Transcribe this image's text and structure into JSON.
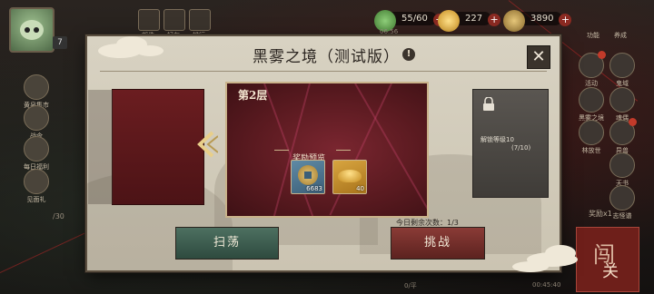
{
  "hud": {
    "level": "7",
    "stamina": "55/60",
    "stamina_timer": "06:56",
    "gold_ingot": "227",
    "coins": "3890",
    "top_icons": [
      {
        "icon": "mail-icon",
        "label": "邮件"
      },
      {
        "icon": "friends-icon",
        "label": "好友"
      },
      {
        "icon": "rank-icon",
        "label": "排行"
      }
    ],
    "left_menu": [
      {
        "icon": "world-icon",
        "label": "黄泉集市"
      },
      {
        "icon": "battle-icon",
        "label": "战令"
      },
      {
        "icon": "welfare-icon",
        "label": "每日福利"
      },
      {
        "icon": "gift-icon",
        "label": "见面礼"
      }
    ],
    "page_indicator": "/30",
    "right_menu": [
      {
        "icon": "event-icon",
        "label": "活动"
      },
      {
        "icon": "ghost-icon",
        "label": "鬼域"
      },
      {
        "icon": "realm-icon",
        "label": "黑雾之境"
      },
      {
        "icon": "mask-icon",
        "label": "魂偶"
      },
      {
        "icon": "tree-icon",
        "label": "林放世"
      },
      {
        "icon": "spirit-icon",
        "label": "异兽"
      },
      {
        "icon": "book-icon",
        "label": "天书"
      },
      {
        "icon": "scroll-icon",
        "label": "志怪谱"
      }
    ],
    "right_top_tabs": [
      "功能",
      "养成"
    ],
    "chat_label": "奖励x1",
    "chuangguan": {
      "bg": "闯",
      "fg": "关"
    },
    "bottom_time": "00:45:40",
    "bottom_status": "0/平"
  },
  "modal": {
    "title": "黑雾之境（测试版）",
    "info_symbol": "!",
    "close_symbol": "✕",
    "floor_label": "第2层",
    "reward_title": "奖励预览",
    "rewards": [
      {
        "icon": "coin-icon",
        "count": "6683"
      },
      {
        "icon": "gold-ingot-icon",
        "count": "40"
      }
    ],
    "locked": {
      "unlock_text": "解锁等级10",
      "progress": "(7/10)"
    },
    "remaining_label": "今日剩余次数：1/3",
    "sweep_button": "扫荡",
    "challenge_button": "挑战"
  },
  "colors": {
    "modal_bg": "#d8d2c2",
    "card_red": "#5a1a20",
    "sweep_green": "#3d5f51",
    "challenge_red": "#7a302c",
    "accent_gold": "#c9b28a"
  }
}
